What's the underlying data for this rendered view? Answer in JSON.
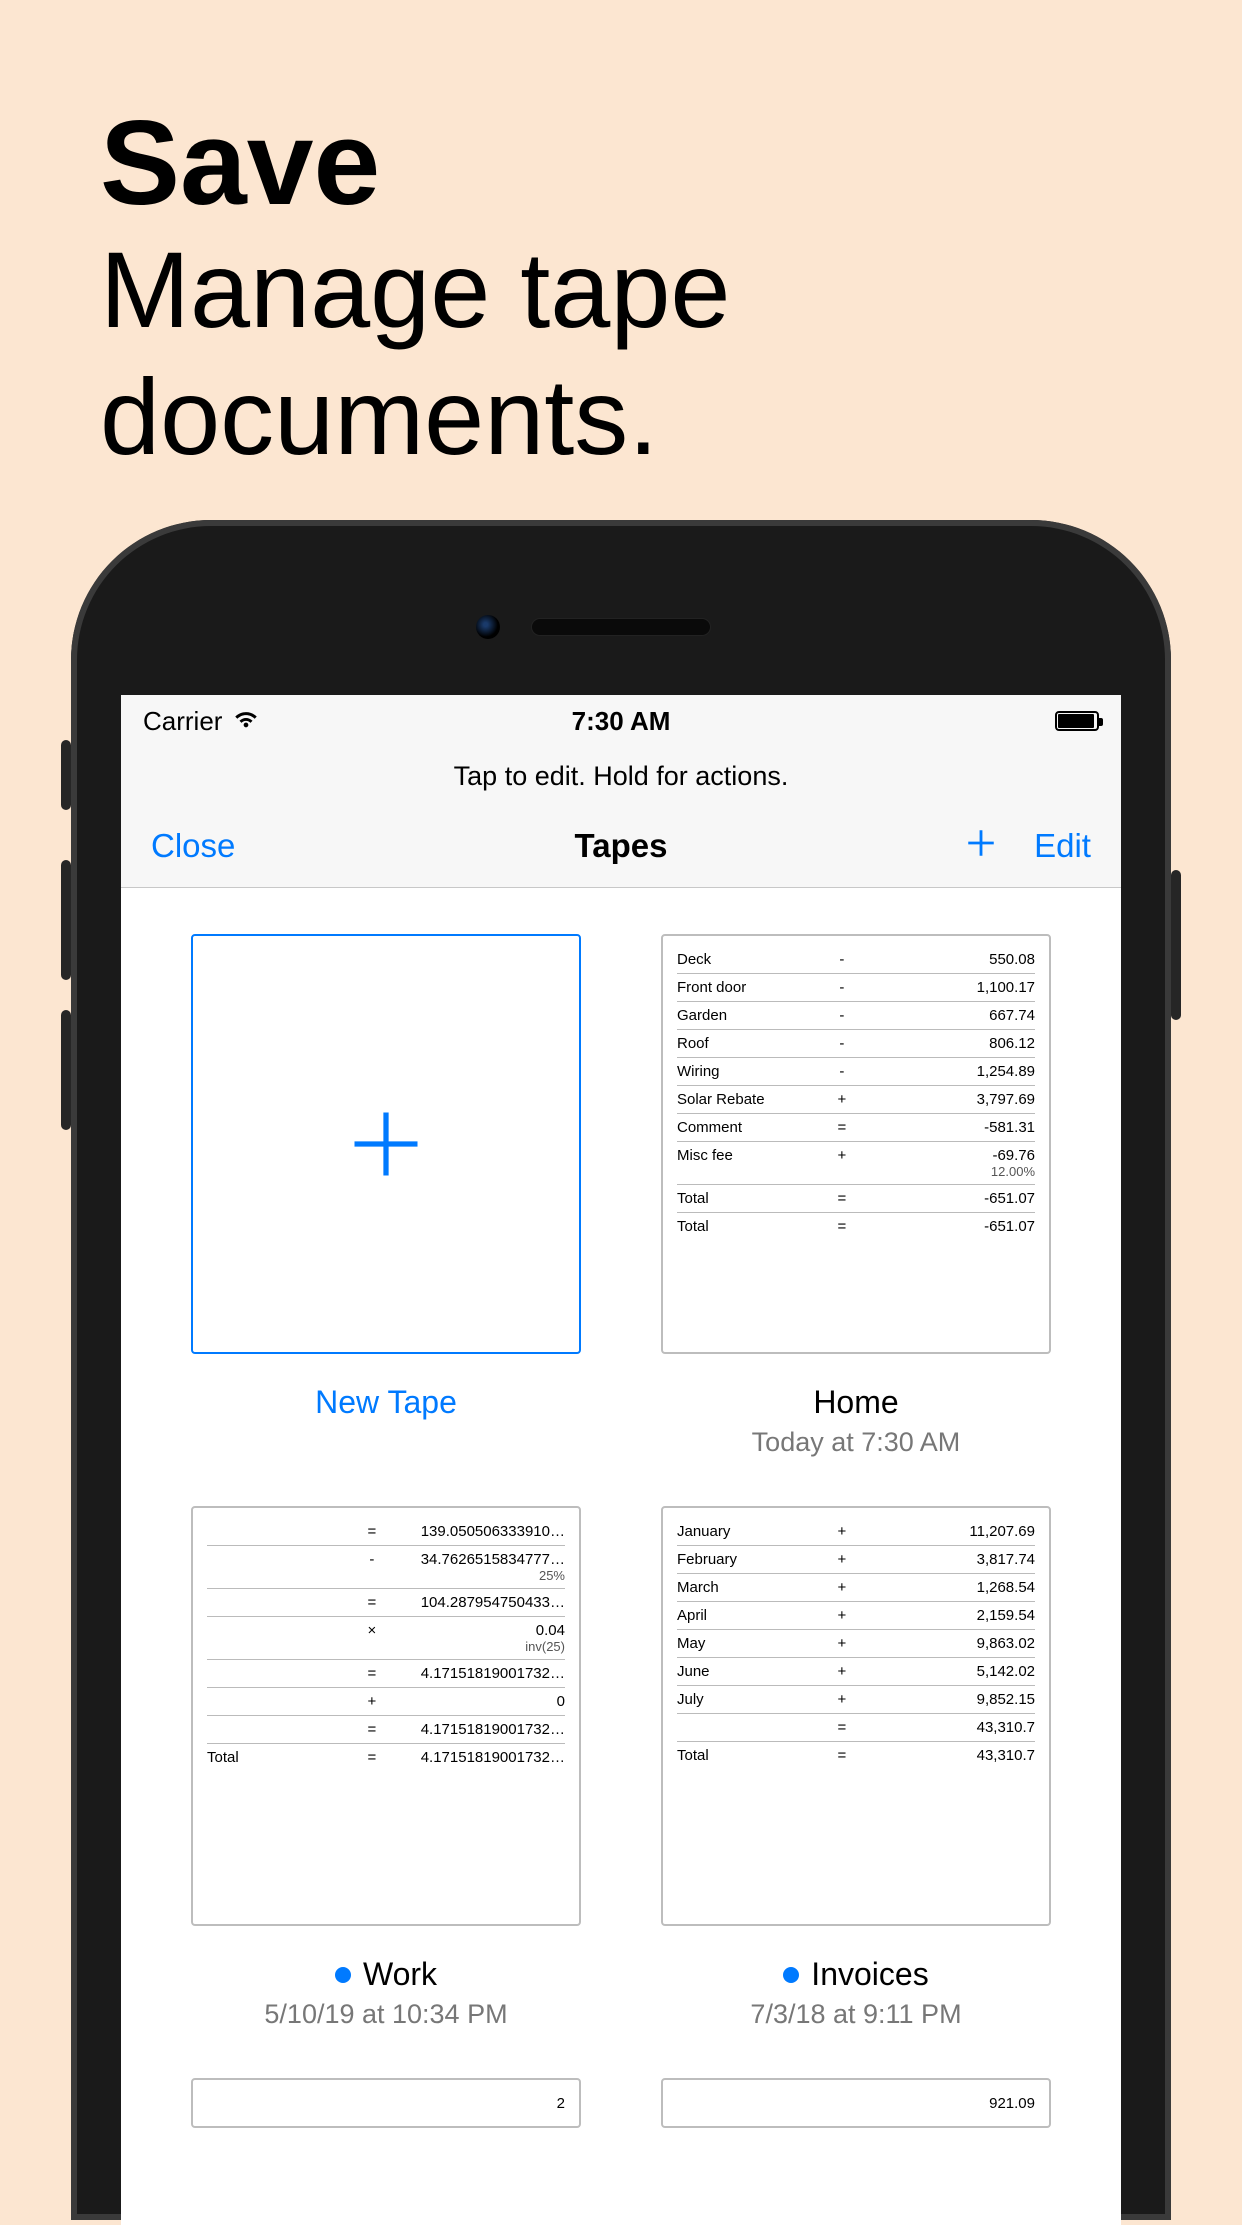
{
  "promo": {
    "bold": "Save",
    "line1": "Manage tape",
    "line2": "documents."
  },
  "status": {
    "carrier": "Carrier",
    "time": "7:30 AM"
  },
  "hint": "Tap to edit. Hold for actions.",
  "nav": {
    "close": "Close",
    "title": "Tapes",
    "edit": "Edit",
    "new_tape_label": "New Tape"
  },
  "tapes": {
    "home": {
      "title": "Home",
      "subtitle": "Today at 7:30 AM",
      "rows": [
        {
          "label": "Deck",
          "op": "-",
          "val": "550.08"
        },
        {
          "label": "Front door",
          "op": "-",
          "val": "1,100.17"
        },
        {
          "label": "Garden",
          "op": "-",
          "val": "667.74"
        },
        {
          "label": "Roof",
          "op": "-",
          "val": "806.12"
        },
        {
          "label": "Wiring",
          "op": "-",
          "val": "1,254.89"
        },
        {
          "label": "Solar Rebate",
          "op": "+",
          "val": "3,797.69"
        },
        {
          "label": "Comment",
          "op": "=",
          "val": "-581.31"
        },
        {
          "label": "Misc fee",
          "op": "+",
          "val": "-69.76",
          "sub": "12.00%"
        },
        {
          "label": "Total",
          "op": "=",
          "val": "-651.07"
        },
        {
          "label": "Total",
          "op": "=",
          "val": "-651.07"
        }
      ]
    },
    "work": {
      "title": "Work",
      "subtitle": "5/10/19 at 10:34 PM",
      "rows": [
        {
          "label": "",
          "op": "=",
          "val": "139.050506333910…"
        },
        {
          "label": "",
          "op": "-",
          "val": "34.7626515834777…",
          "sub": "25%"
        },
        {
          "label": "",
          "op": "=",
          "val": "104.287954750433…"
        },
        {
          "label": "",
          "op": "×",
          "val": "0.04",
          "sub": "inv(25)"
        },
        {
          "label": "",
          "op": "=",
          "val": "4.17151819001732…"
        },
        {
          "label": "",
          "op": "+",
          "val": "0"
        },
        {
          "label": "",
          "op": "=",
          "val": "4.17151819001732…"
        },
        {
          "label": "Total",
          "op": "=",
          "val": "4.17151819001732…"
        }
      ]
    },
    "invoices": {
      "title": "Invoices",
      "subtitle": "7/3/18 at 9:11 PM",
      "rows": [
        {
          "label": "January",
          "op": "+",
          "val": "11,207.69"
        },
        {
          "label": "February",
          "op": "+",
          "val": "3,817.74"
        },
        {
          "label": "March",
          "op": "+",
          "val": "1,268.54"
        },
        {
          "label": "April",
          "op": "+",
          "val": "2,159.54"
        },
        {
          "label": "May",
          "op": "+",
          "val": "9,863.02"
        },
        {
          "label": "June",
          "op": "+",
          "val": "5,142.02"
        },
        {
          "label": "July",
          "op": "+",
          "val": "9,852.15"
        },
        {
          "label": "",
          "op": "=",
          "val": "43,310.7"
        },
        {
          "label": "Total",
          "op": "=",
          "val": "43,310.7"
        }
      ]
    },
    "extra1": {
      "val": "2"
    },
    "extra2": {
      "val": "921.09"
    }
  }
}
